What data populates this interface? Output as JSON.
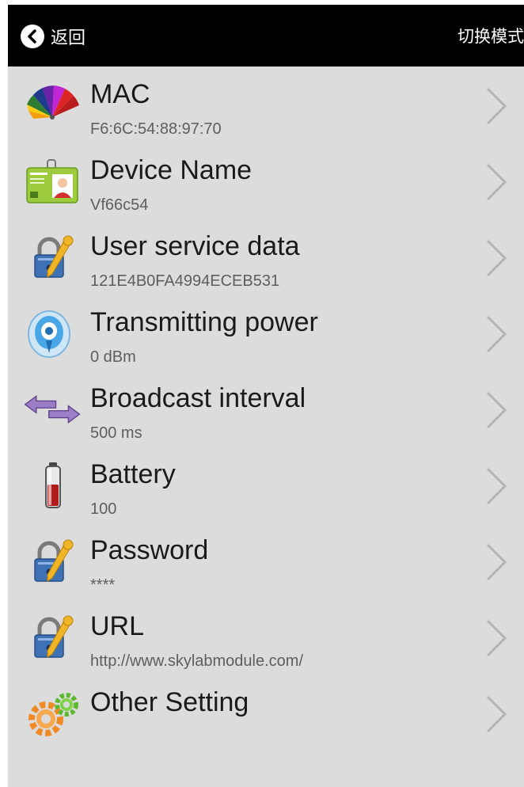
{
  "topbar": {
    "back_label": "返回",
    "switch_mode_label": "切换模式"
  },
  "icons": {
    "back": "chevron-left-circle-icon",
    "item_chevron": "chevron-right-icon"
  },
  "items": [
    {
      "label": "MAC",
      "value": "F6:6C:54:88:97:70",
      "icon": "color-fan-icon"
    },
    {
      "label": "Device Name",
      "value": "Vf66c54",
      "icon": "id-card-icon"
    },
    {
      "label": "User service data",
      "value": "121E4B0FA4994ECEB531",
      "icon": "lock-key-icon"
    },
    {
      "label": "Transmitting power",
      "value": "0 dBm",
      "icon": "signal-tag-icon"
    },
    {
      "label": "Broadcast interval",
      "value": "500 ms",
      "icon": "double-arrow-icon"
    },
    {
      "label": "Battery",
      "value": "100",
      "icon": "battery-icon"
    },
    {
      "label": "Password",
      "value": "****",
      "icon": "lock-key-icon"
    },
    {
      "label": "URL",
      "value": "http://www.skylabmodule.com/",
      "icon": "lock-key-icon"
    },
    {
      "label": "Other Setting",
      "value": "",
      "icon": "gears-icon"
    }
  ]
}
